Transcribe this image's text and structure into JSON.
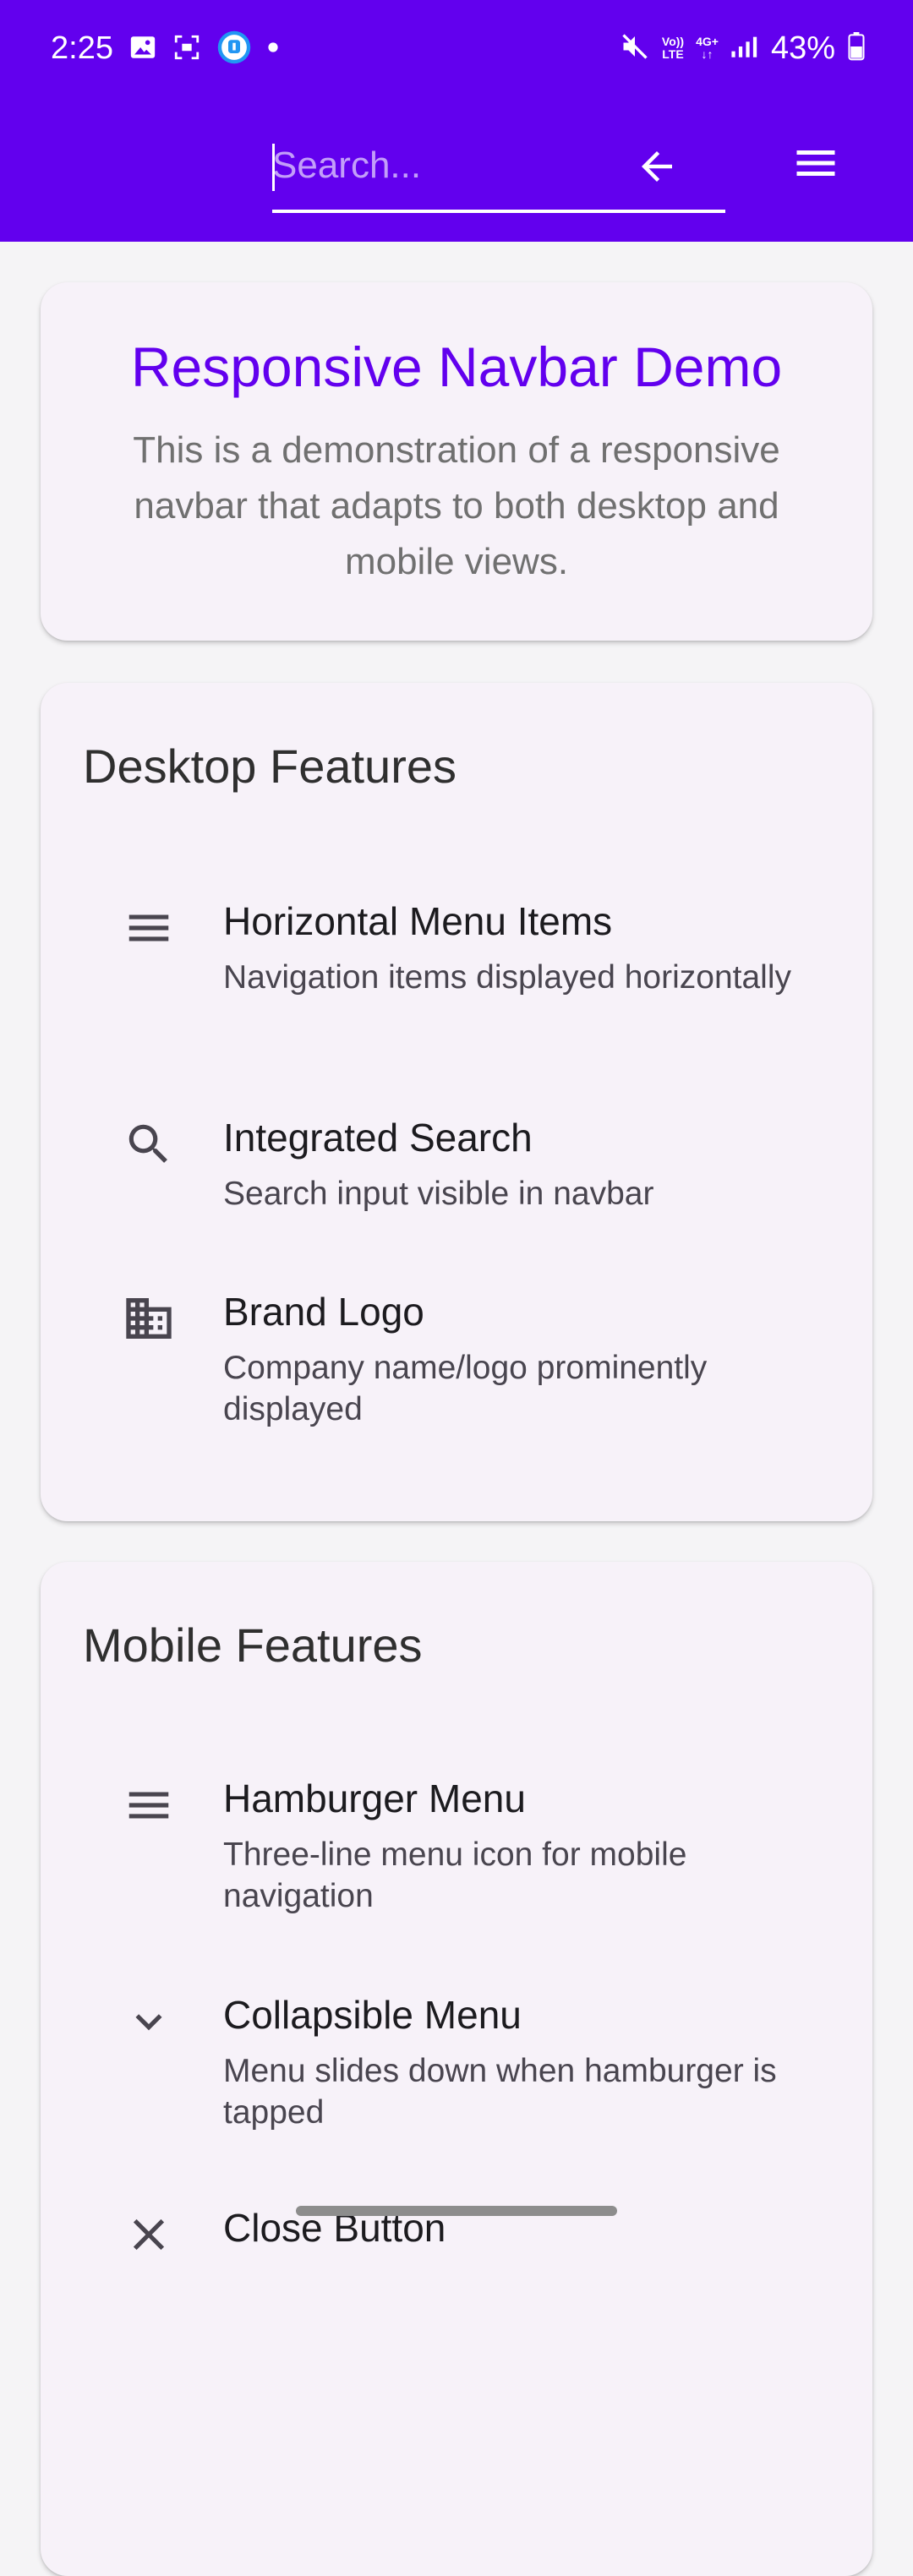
{
  "status_bar": {
    "time": "2:25",
    "battery": "43%",
    "network_top": "Vo)) LTE",
    "network_mid": "4G+"
  },
  "app_bar": {
    "color": "#6200ee",
    "search_placeholder": "Search...",
    "search_value": ""
  },
  "intro": {
    "title": "Responsive Navbar Demo",
    "text": "This is a demonstration of a responsive navbar that adapts to both desktop and mobile views."
  },
  "desktop_section": {
    "title": "Desktop Features",
    "items": [
      {
        "icon": "menu-icon",
        "title": "Horizontal Menu Items",
        "subtitle": "Navigation items displayed horizontally"
      },
      {
        "icon": "search-icon",
        "title": "Integrated Search",
        "subtitle": "Search input visible in navbar"
      },
      {
        "icon": "business-icon",
        "title": "Brand Logo",
        "subtitle": "Company name/logo prominently displayed"
      }
    ]
  },
  "mobile_section": {
    "title": "Mobile Features",
    "items": [
      {
        "icon": "menu-icon",
        "title": "Hamburger Menu",
        "subtitle": "Three-line menu icon for mobile navigation"
      },
      {
        "icon": "chevron-down-icon",
        "title": "Collapsible Menu",
        "subtitle": "Menu slides down when hamburger is tapped"
      },
      {
        "icon": "close-icon",
        "title": "Close Button",
        "subtitle": ""
      }
    ]
  }
}
